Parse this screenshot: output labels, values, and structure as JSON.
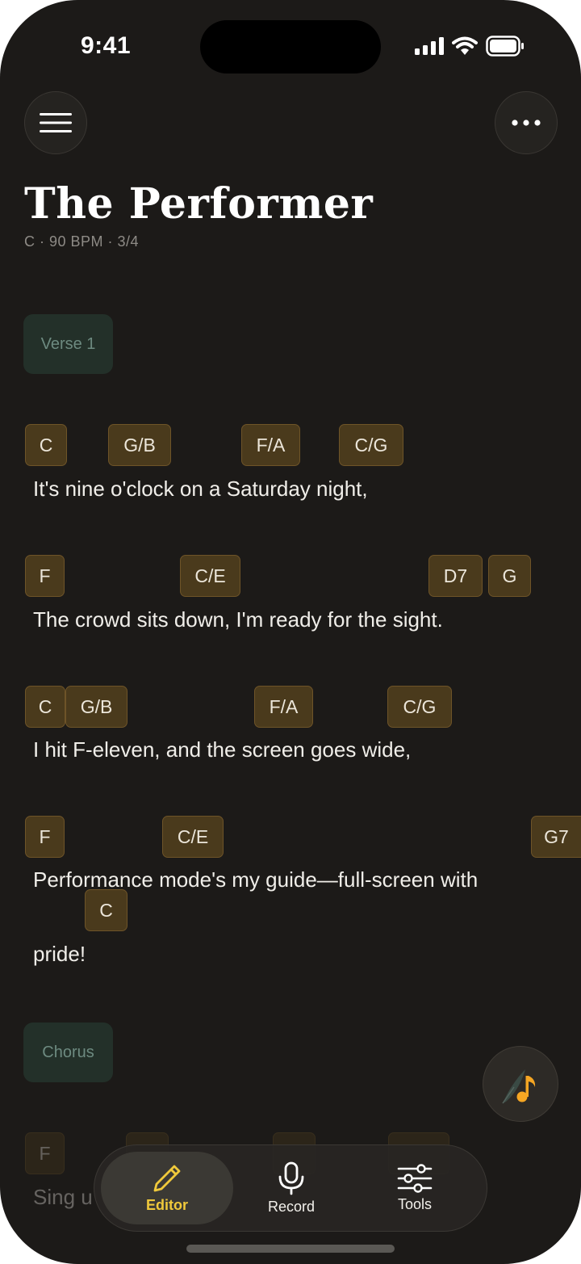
{
  "status_bar": {
    "time": "9:41"
  },
  "header": {
    "menu_icon": "hamburger-menu-icon",
    "more_icon": "ellipsis-icon"
  },
  "song": {
    "title": "The Performer",
    "meta": "C · 90 BPM · 3/4"
  },
  "sections": [
    {
      "label": "Verse 1",
      "lines": [
        {
          "lyric": "It's nine o'clock on a Saturday night,",
          "chords": [
            "C",
            "G/B",
            "F/A",
            "C/G"
          ]
        },
        {
          "lyric": "The crowd sits down, I'm ready for the sight.",
          "chords": [
            "F",
            "C/E",
            "D7",
            "G"
          ]
        },
        {
          "lyric": "I hit F-eleven, and the screen goes wide,",
          "chords": [
            "C",
            "G/B",
            "F/A",
            "C/G"
          ]
        },
        {
          "lyric": "Performance mode's my guide—full-screen with",
          "chords": [
            "F",
            "C/E",
            "G7"
          ]
        },
        {
          "lyric": "pride!",
          "chords": [
            "C"
          ]
        }
      ]
    },
    {
      "label": "Chorus",
      "lines": [
        {
          "lyric": "Sing u",
          "chords": [
            "F"
          ]
        }
      ]
    }
  ],
  "fab": {
    "icon": "music-note-quill-icon"
  },
  "tab_bar": {
    "tabs": [
      {
        "label": "Editor",
        "icon": "pencil-icon",
        "active": true
      },
      {
        "label": "Record",
        "icon": "microphone-icon",
        "active": false
      },
      {
        "label": "Tools",
        "icon": "sliders-icon",
        "active": false
      }
    ]
  },
  "colors": {
    "background": "#1c1a18",
    "chord_fill": "#4a3a1c",
    "section_fill": "#233029",
    "accent": "#f0c93b",
    "fab_note": "#f5a623"
  }
}
